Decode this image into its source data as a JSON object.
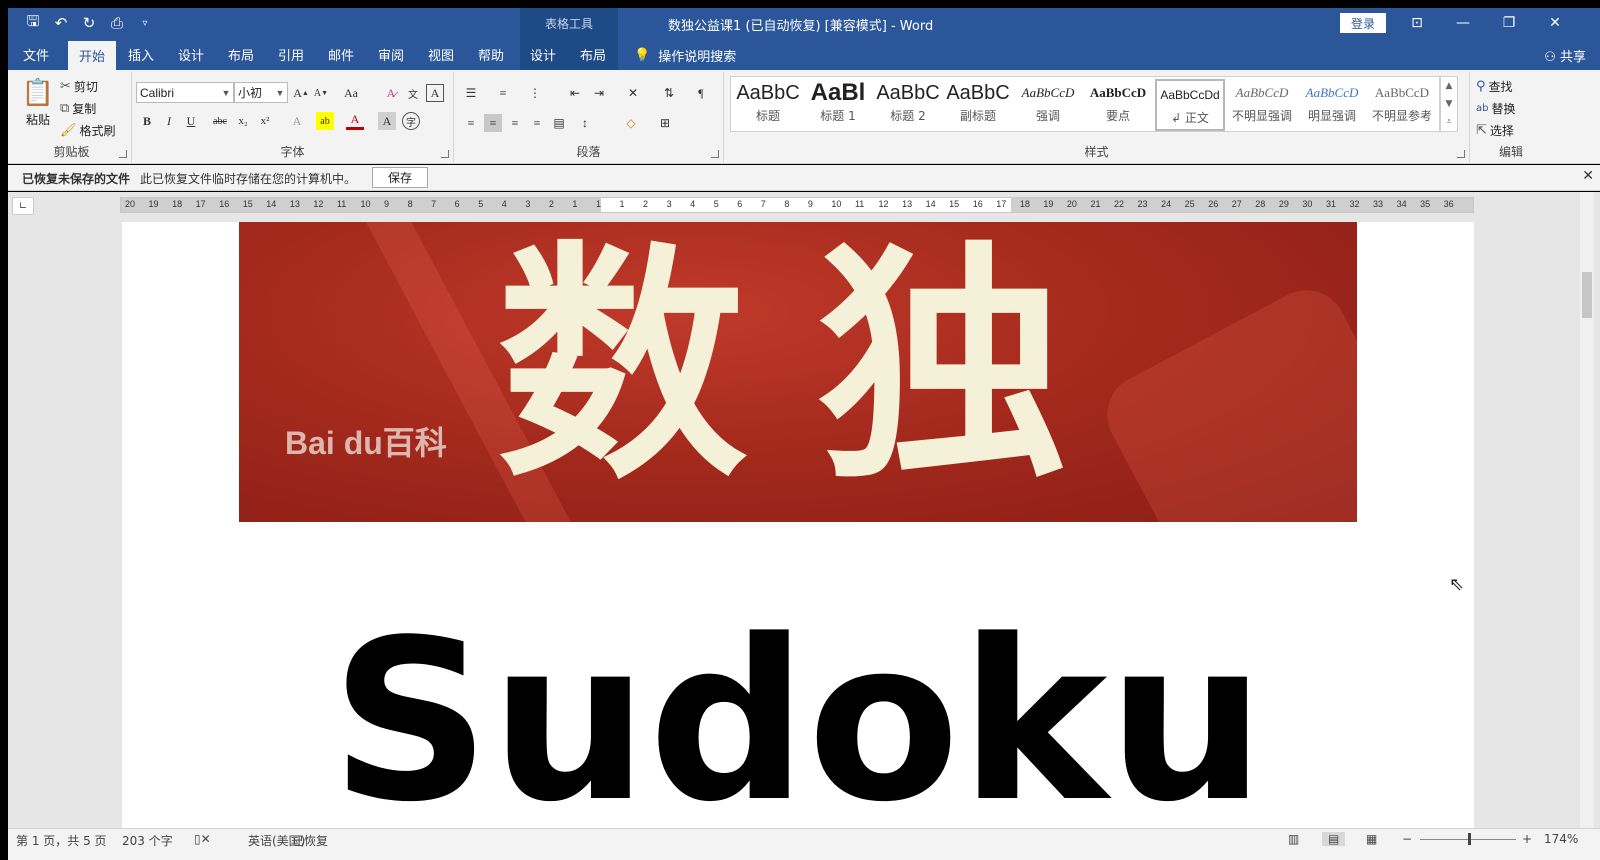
{
  "titlebar": {
    "context_tool": "表格工具",
    "document_title": "数独公益课1 (已自动恢复) [兼容模式]  -  Word",
    "login": "登录"
  },
  "tabs": [
    "文件",
    "开始",
    "插入",
    "设计",
    "布局",
    "引用",
    "邮件",
    "审阅",
    "视图",
    "帮助",
    "设计",
    "布局"
  ],
  "active_tab": "开始",
  "tell_me": "操作说明搜索",
  "share": "共享",
  "ribbon": {
    "clipboard": {
      "paste": "粘贴",
      "cut": "剪切",
      "copy": "复制",
      "format_painter": "格式刷",
      "label": "剪贴板"
    },
    "font": {
      "font_name": "Calibri",
      "font_size": "小初",
      "change_case": "Aa",
      "label": "字体"
    },
    "paragraph": {
      "label": "段落"
    },
    "styles": {
      "label": "样式",
      "items": [
        {
          "sample": "AaBbC",
          "name": "标题"
        },
        {
          "sample": "AaBl",
          "name": "标题 1"
        },
        {
          "sample": "AaBbC",
          "name": "标题 2"
        },
        {
          "sample": "AaBbC",
          "name": "副标题"
        },
        {
          "sample": "AaBbCcD",
          "name": "强调"
        },
        {
          "sample": "AaBbCcD",
          "name": "要点"
        },
        {
          "sample": "AaBbCcDd",
          "name": "↲ 正文"
        },
        {
          "sample": "AaBbCcD",
          "name": "不明显强调"
        },
        {
          "sample": "AaBbCcD",
          "name": "明显强调"
        },
        {
          "sample": "AaBbCcD",
          "name": "不明显参考"
        }
      ],
      "selected_index": 6
    },
    "editing": {
      "find": "查找",
      "replace": "替换",
      "select": "选择",
      "label": "编辑"
    }
  },
  "infobar": {
    "title": "已恢复未保存的文件",
    "message": "此已恢复文件临时存储在您的计算机中。",
    "save": "保存"
  },
  "ruler_numbers": [
    "20",
    "19",
    "18",
    "17",
    "16",
    "15",
    "14",
    "13",
    "12",
    "11",
    "10",
    "9",
    "8",
    "7",
    "6",
    "5",
    "4",
    "3",
    "2",
    "1",
    "1",
    "1",
    "2",
    "3",
    "4",
    "5",
    "6",
    "7",
    "8",
    "9",
    "10",
    "11",
    "12",
    "13",
    "14",
    "15",
    "16",
    "17",
    "18",
    "19",
    "20",
    "21",
    "22",
    "23",
    "24",
    "25",
    "26",
    "27",
    "28",
    "29",
    "30",
    "31",
    "32",
    "33",
    "34",
    "35",
    "36"
  ],
  "document": {
    "banner_title": "数独",
    "banner_logo": "Bai du百科",
    "heading": "Sudoku"
  },
  "statusbar": {
    "page": "第 1 页，共 5 页",
    "words": "203 个字",
    "language": "英语(美国)",
    "recovered": "已恢复",
    "zoom": "174%"
  },
  "colors": {
    "word_blue": "#2b579a",
    "banner_red": "#a52a1d",
    "banner_text": "#f5f0d8"
  }
}
